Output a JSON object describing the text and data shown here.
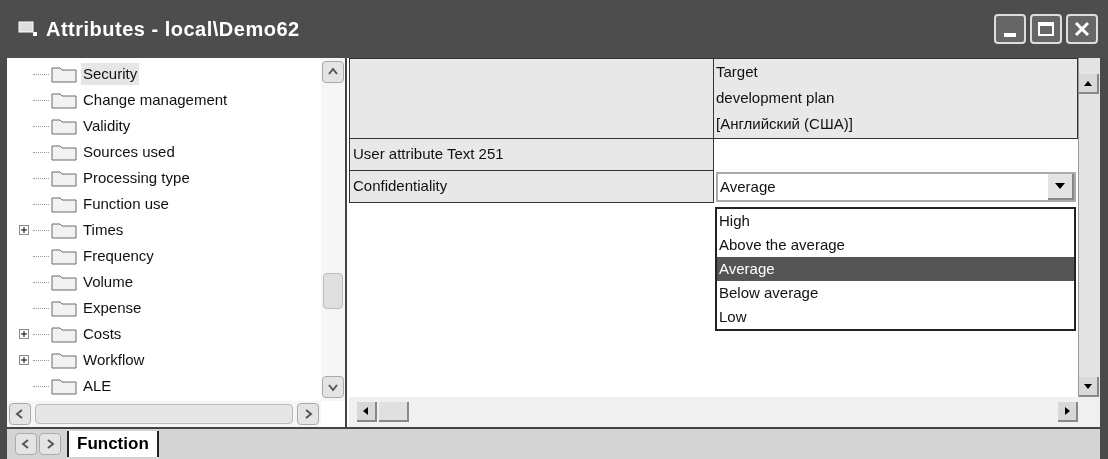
{
  "window": {
    "title": "Attributes - local\\Demo62"
  },
  "tree": {
    "items": [
      {
        "label": "Security",
        "kind": "leaf",
        "selected": true
      },
      {
        "label": "Change management",
        "kind": "leaf",
        "selected": false
      },
      {
        "label": "Validity",
        "kind": "leaf",
        "selected": false
      },
      {
        "label": "Sources used",
        "kind": "leaf",
        "selected": false
      },
      {
        "label": "Processing type",
        "kind": "leaf",
        "selected": false
      },
      {
        "label": "Function use",
        "kind": "leaf",
        "selected": false
      },
      {
        "label": "Times",
        "kind": "collapsed",
        "selected": false
      },
      {
        "label": "Frequency",
        "kind": "leaf",
        "selected": false
      },
      {
        "label": "Volume",
        "kind": "leaf",
        "selected": false
      },
      {
        "label": "Expense",
        "kind": "leaf",
        "selected": false
      },
      {
        "label": "Costs",
        "kind": "collapsed",
        "selected": false
      },
      {
        "label": "Workflow",
        "kind": "collapsed",
        "selected": false
      },
      {
        "label": "ALE",
        "kind": "leaf",
        "selected": false
      }
    ]
  },
  "grid": {
    "column_header": [
      "Target",
      "development plan",
      "[Английский (США)]"
    ],
    "rows": [
      {
        "name": "User attribute Text 251",
        "kind": "text",
        "value": ""
      },
      {
        "name": "Confidentiality",
        "kind": "dropdown",
        "value": "Average"
      }
    ],
    "dropdown_options": [
      {
        "label": "High",
        "selected": false
      },
      {
        "label": "Above the average",
        "selected": false
      },
      {
        "label": "Average",
        "selected": true
      },
      {
        "label": "Below average",
        "selected": false
      },
      {
        "label": "Low",
        "selected": false
      }
    ]
  },
  "sheet_tabs": [
    {
      "label": "Function",
      "selected": true
    }
  ]
}
